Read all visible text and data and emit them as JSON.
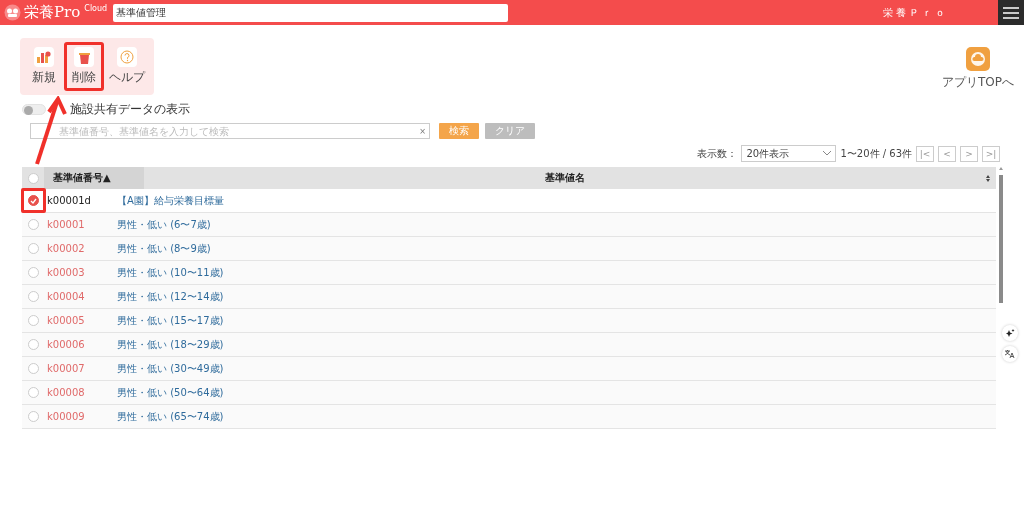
{
  "header": {
    "logo_text": "栄養Pro",
    "logo_sup": "Cloud",
    "title": "基準値管理",
    "app_name": "栄養Ｐｒｏ"
  },
  "toolbar": [
    {
      "kind": "new",
      "label": "新規",
      "highlighted": false
    },
    {
      "kind": "delete",
      "label": "削除",
      "highlighted": true
    },
    {
      "kind": "help",
      "label": "ヘルプ",
      "highlighted": false
    }
  ],
  "app_top": {
    "label": "アプリTOPへ"
  },
  "shared_toggle": {
    "label": "施設共有データの表示",
    "on": false
  },
  "search": {
    "placeholder": "基準値番号、基準値名を入力して検索",
    "clear_icon": "×",
    "search_button": "検索",
    "clear_button": "クリア"
  },
  "pagination": {
    "label": "表示数：",
    "page_size": "20件表示",
    "range": "1〜20件 / 63件",
    "buttons": [
      "|<",
      "<",
      ">",
      ">|"
    ]
  },
  "table": {
    "select_all": false,
    "columns": [
      "基準値番号▲",
      "基準値名"
    ],
    "rows": [
      {
        "number": "k00001d",
        "name": "【A園】給与栄養目標量",
        "selected": true
      },
      {
        "number": "k00001",
        "name": "男性・低い (6〜7歳)",
        "selected": false
      },
      {
        "number": "k00002",
        "name": "男性・低い (8〜9歳)",
        "selected": false
      },
      {
        "number": "k00003",
        "name": "男性・低い (10〜11歳)",
        "selected": false
      },
      {
        "number": "k00004",
        "name": "男性・低い (12〜14歳)",
        "selected": false
      },
      {
        "number": "k00005",
        "name": "男性・低い (15〜17歳)",
        "selected": false
      },
      {
        "number": "k00006",
        "name": "男性・低い (18〜29歳)",
        "selected": false
      },
      {
        "number": "k00007",
        "name": "男性・低い (30〜49歳)",
        "selected": false
      },
      {
        "number": "k00008",
        "name": "男性・低い (50〜64歳)",
        "selected": false
      },
      {
        "number": "k00009",
        "name": "男性・低い (65〜74歳)",
        "selected": false
      }
    ]
  }
}
